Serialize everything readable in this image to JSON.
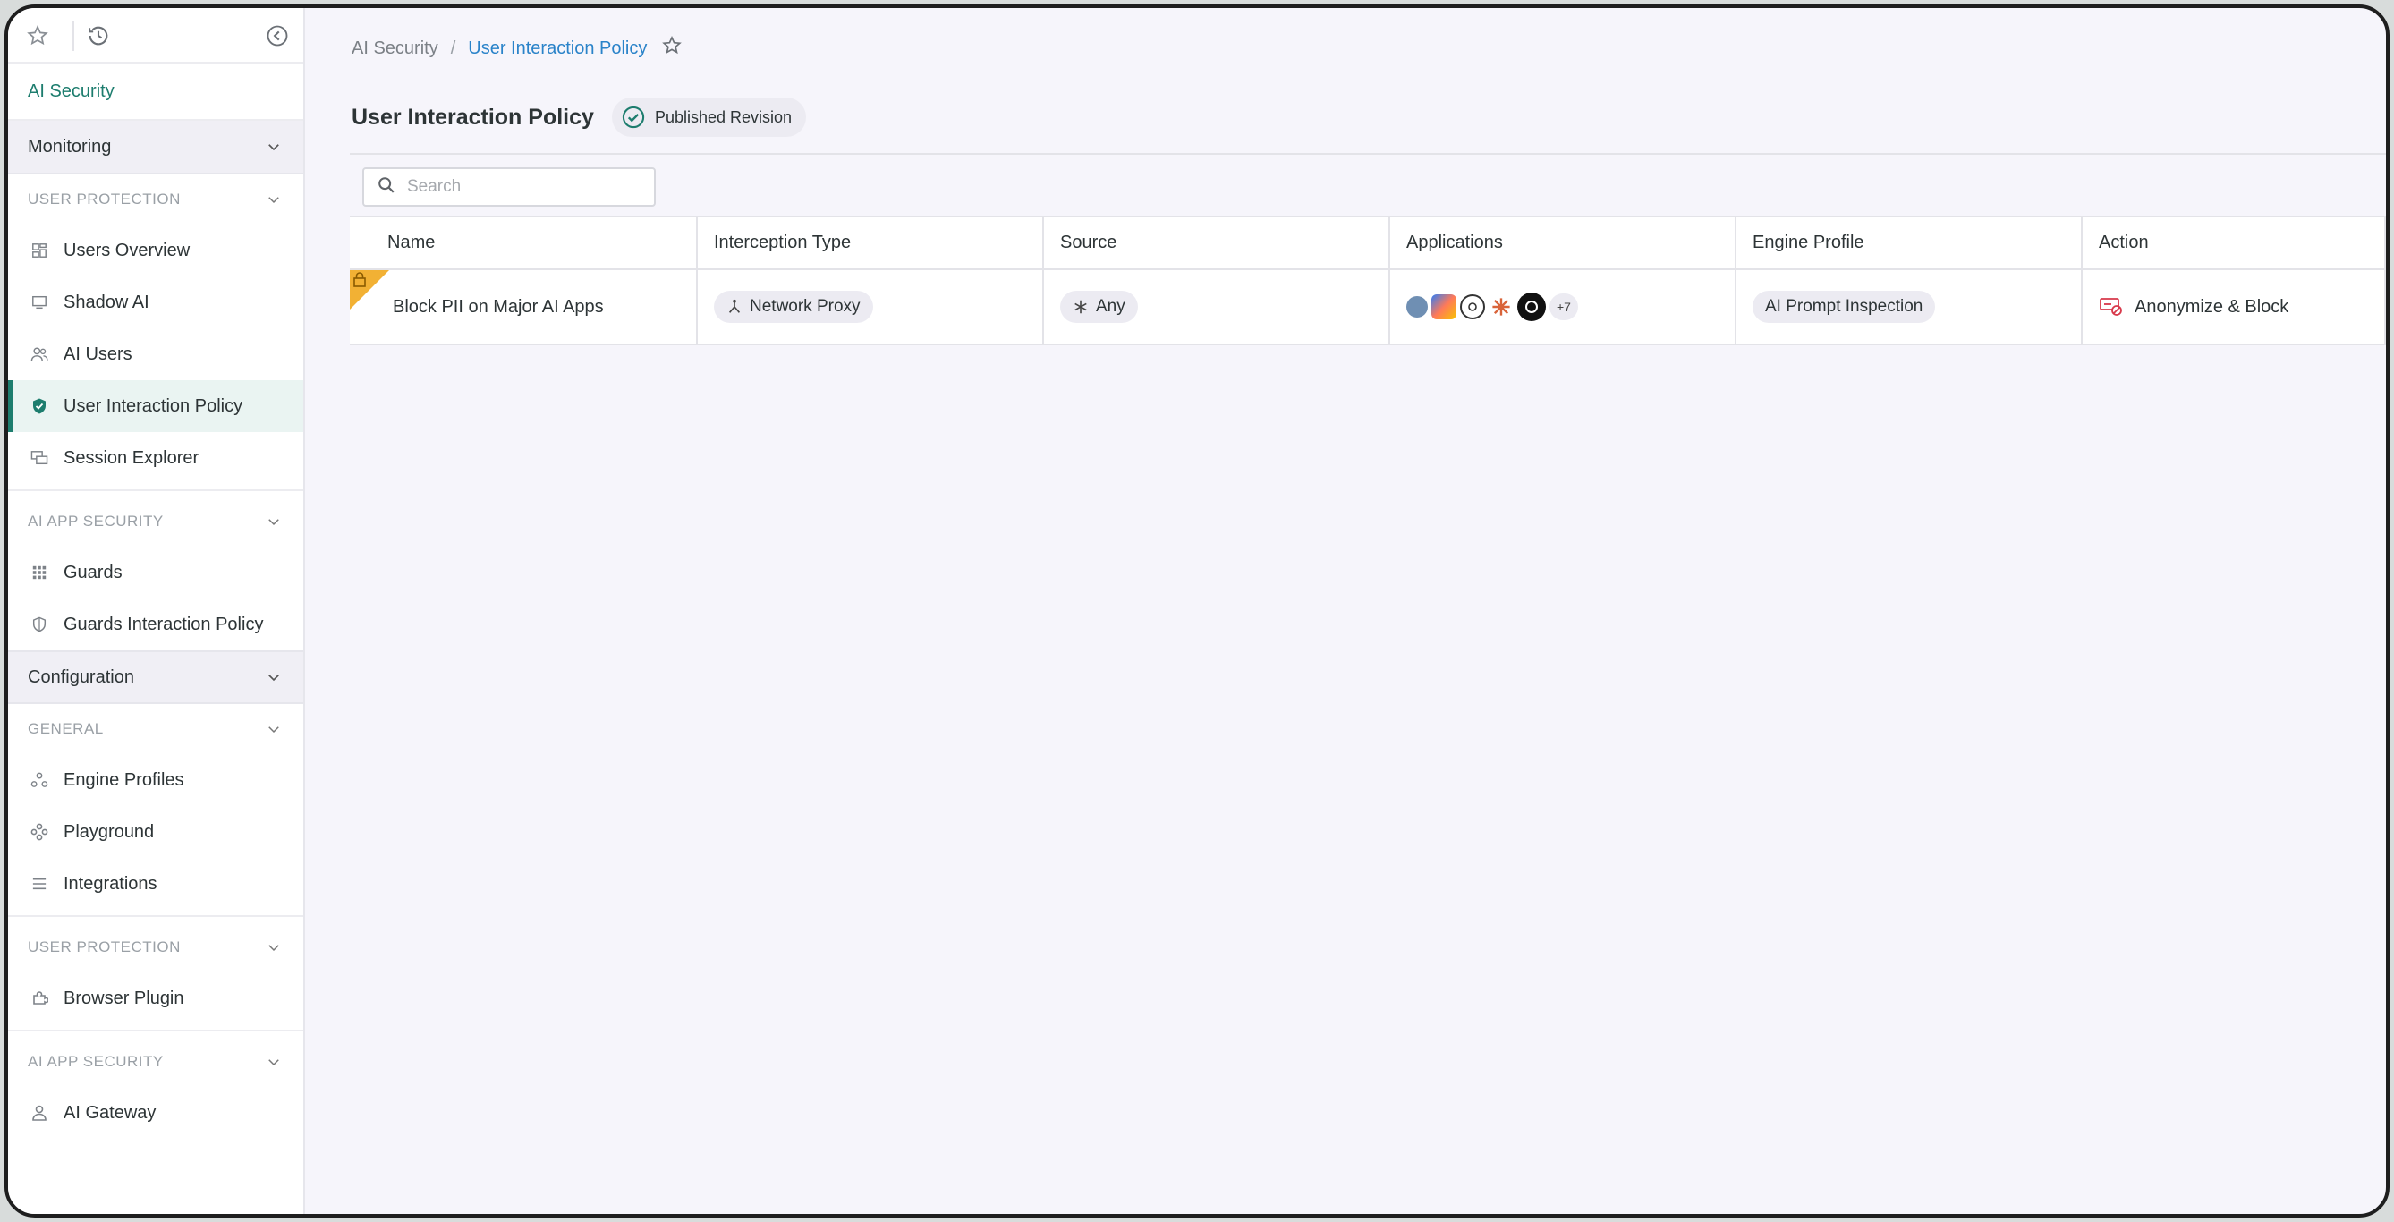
{
  "sidebar": {
    "app_title": "AI Security",
    "sections": {
      "monitoring": "Monitoring",
      "configuration": "Configuration"
    },
    "groups": {
      "user_protection": "USER PROTECTION",
      "ai_app_security": "AI APP SECURITY",
      "general": "GENERAL",
      "user_protection_2": "USER PROTECTION",
      "ai_app_security_2": "AI APP SECURITY"
    },
    "items": {
      "users_overview": "Users Overview",
      "shadow_ai": "Shadow AI",
      "ai_users": "AI Users",
      "user_interaction_policy": "User Interaction Policy",
      "session_explorer": "Session Explorer",
      "guards": "Guards",
      "guards_interaction_policy": "Guards Interaction Policy",
      "engine_profiles": "Engine Profiles",
      "playground": "Playground",
      "integrations": "Integrations",
      "browser_plugin": "Browser Plugin",
      "ai_gateway": "AI Gateway"
    }
  },
  "breadcrumb": {
    "root": "AI Security",
    "separator": "/",
    "current": "User Interaction Policy"
  },
  "page": {
    "title": "User Interaction Policy",
    "status": "Published Revision"
  },
  "search": {
    "placeholder": "Search"
  },
  "table": {
    "columns": {
      "name": "Name",
      "interception_type": "Interception Type",
      "source": "Source",
      "applications": "Applications",
      "engine_profile": "Engine Profile",
      "action": "Action"
    },
    "rows": [
      {
        "name": "Block PII on Major AI Apps",
        "interception_type": "Network Proxy",
        "source": "Any",
        "apps_more": "+7",
        "engine_profile": "AI Prompt Inspection",
        "action": "Anonymize & Block"
      }
    ]
  },
  "colors": {
    "accent": "#1d7d6e",
    "link": "#2a83c9",
    "lock_badge": "#f2b134",
    "action_icon": "#d8394b"
  }
}
